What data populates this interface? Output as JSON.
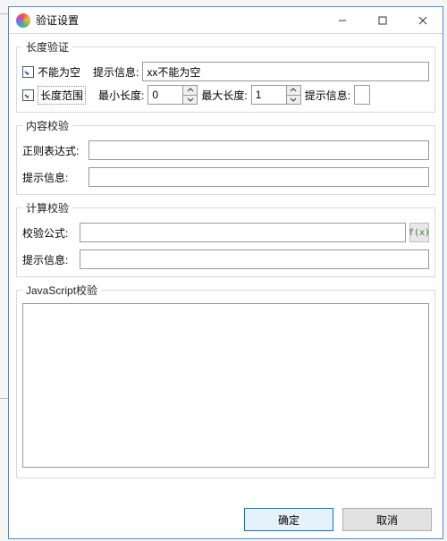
{
  "window": {
    "title": "验证设置",
    "buttons": {
      "min": "—",
      "max": "☐",
      "close": "✕"
    }
  },
  "group1": {
    "legend": "长度验证",
    "not_empty": {
      "checked": true,
      "label": "不能为空"
    },
    "hint_label": "提示信息:",
    "hint_value": "xx不能为空",
    "length_range": {
      "checked": true,
      "label": "长度范围"
    },
    "min_len_label": "最小长度:",
    "min_len_value": "0",
    "max_len_label": "最大长度:",
    "max_len_value": "1",
    "hint2_label": "提示信息:"
  },
  "group2": {
    "legend": "内容校验",
    "regex_label": "正则表达式:",
    "regex_value": "",
    "hint_label": "提示信息:",
    "hint_value": ""
  },
  "group3": {
    "legend": "计算校验",
    "formula_label": "校验公式:",
    "formula_value": "",
    "fx_label": "f(x)",
    "hint_label": "提示信息:",
    "hint_value": ""
  },
  "group4": {
    "legend": "JavaScript校验",
    "value": ""
  },
  "footer": {
    "ok": "确定",
    "cancel": "取消"
  }
}
